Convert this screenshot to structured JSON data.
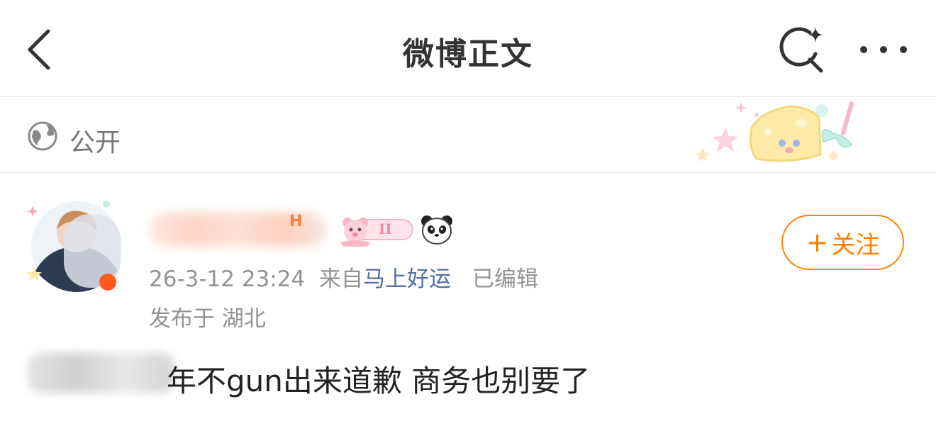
{
  "header": {
    "title": "微博正文",
    "back_icon": "chevron-left-icon",
    "search_icon": "search-sparkle-icon",
    "more_icon": "more-dots-icon"
  },
  "privacy": {
    "icon": "globe-icon",
    "label": "公开",
    "decoration": "cheese-sticker-icon"
  },
  "author": {
    "nickname_tail": "H",
    "member_badge_text": "II",
    "badge_icon": "bear-member-badge-icon",
    "emoji_icon": "panda-icon",
    "timestamp": "26-3-12 23:24",
    "source_prefix": "来自",
    "source_app": "马上好运",
    "edited_label": "已编辑",
    "location_prefix": "发布于",
    "location": "湖北",
    "follow_plus": "+",
    "follow_label": "关注"
  },
  "post": {
    "text": "年不gun出来道歉 商务也别要了"
  },
  "colors": {
    "accent": "#ff8200",
    "link": "#4f6fa6",
    "meta": "#939393",
    "divider": "#e6e6e6"
  }
}
